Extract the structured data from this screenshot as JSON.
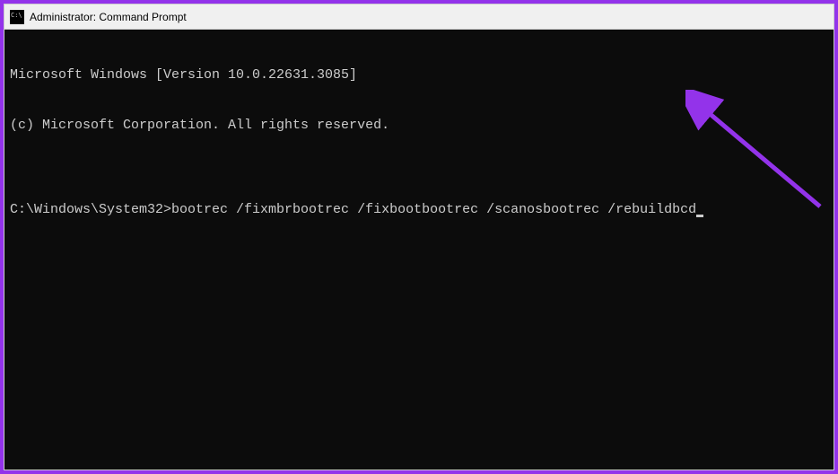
{
  "titlebar": {
    "title": "Administrator: Command Prompt"
  },
  "terminal": {
    "line1": "Microsoft Windows [Version 10.0.22631.3085]",
    "line2": "(c) Microsoft Corporation. All rights reserved.",
    "blank": "",
    "prompt": "C:\\Windows\\System32>",
    "command": "bootrec /fixmbrbootrec /fixbootbootrec /scanosbootrec /rebuildbcd"
  },
  "annotation": {
    "arrow_color": "#9333ea"
  }
}
